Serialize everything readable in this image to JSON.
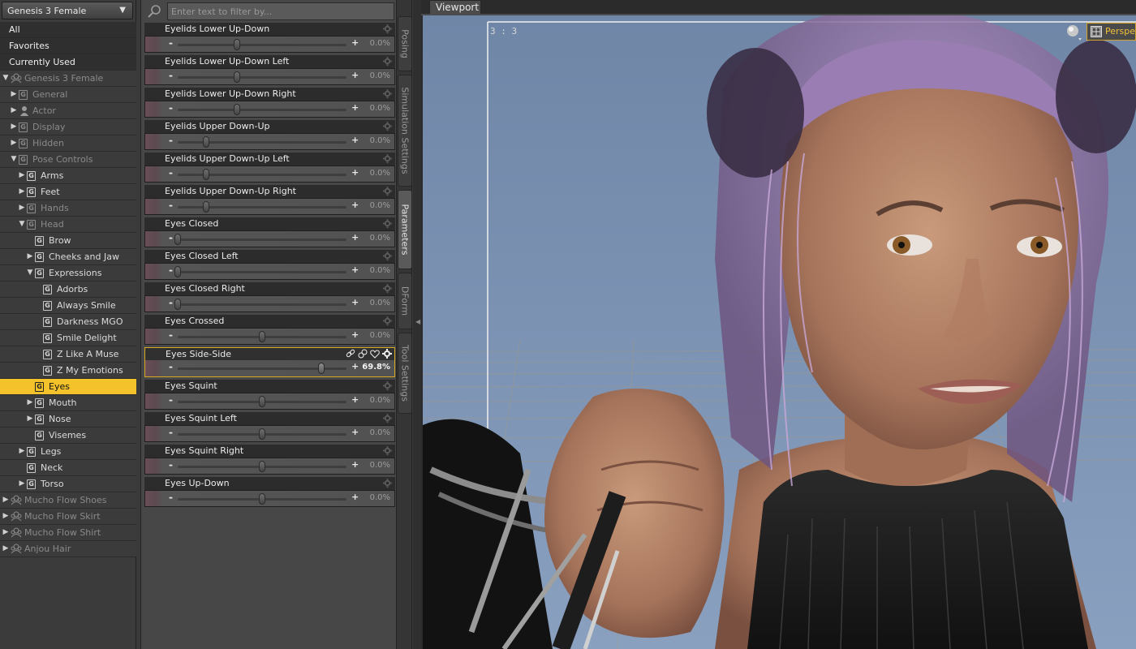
{
  "figure_selector": {
    "value": "Genesis 3 Female"
  },
  "tree": [
    {
      "label": "All",
      "kind": "top"
    },
    {
      "label": "Favorites",
      "kind": "top"
    },
    {
      "label": "Currently Used",
      "kind": "top"
    },
    {
      "label": "Genesis 3 Female",
      "kind": "figure",
      "depth": 0,
      "twisty": "open",
      "dim": true
    },
    {
      "label": "General",
      "kind": "group",
      "depth": 1,
      "twisty": "closed",
      "dim": true
    },
    {
      "label": "Actor",
      "kind": "actor",
      "depth": 1,
      "twisty": "closed",
      "dim": true
    },
    {
      "label": "Display",
      "kind": "group",
      "depth": 1,
      "twisty": "closed",
      "dim": true
    },
    {
      "label": "Hidden",
      "kind": "group",
      "depth": 1,
      "twisty": "closed",
      "dim": true
    },
    {
      "label": "Pose Controls",
      "kind": "group",
      "depth": 1,
      "twisty": "open",
      "dim": true
    },
    {
      "label": "Arms",
      "kind": "group",
      "depth": 2,
      "twisty": "closed"
    },
    {
      "label": "Feet",
      "kind": "group",
      "depth": 2,
      "twisty": "closed"
    },
    {
      "label": "Hands",
      "kind": "group",
      "depth": 2,
      "twisty": "closed",
      "dim": true
    },
    {
      "label": "Head",
      "kind": "group",
      "depth": 2,
      "twisty": "open",
      "dim": true
    },
    {
      "label": "Brow",
      "kind": "group",
      "depth": 3,
      "twisty": "none"
    },
    {
      "label": "Cheeks and Jaw",
      "kind": "group",
      "depth": 3,
      "twisty": "closed"
    },
    {
      "label": "Expressions",
      "kind": "group",
      "depth": 3,
      "twisty": "open"
    },
    {
      "label": "Adorbs",
      "kind": "group",
      "depth": 4,
      "twisty": "none"
    },
    {
      "label": "Always Smile",
      "kind": "group",
      "depth": 4,
      "twisty": "none"
    },
    {
      "label": "Darkness MGO",
      "kind": "group",
      "depth": 4,
      "twisty": "none"
    },
    {
      "label": "Smile Delight",
      "kind": "group",
      "depth": 4,
      "twisty": "none"
    },
    {
      "label": "Z Like A Muse",
      "kind": "group",
      "depth": 4,
      "twisty": "none"
    },
    {
      "label": "Z My Emotions",
      "kind": "group",
      "depth": 4,
      "twisty": "none"
    },
    {
      "label": "Eyes",
      "kind": "group",
      "depth": 3,
      "twisty": "none",
      "selected": true
    },
    {
      "label": "Mouth",
      "kind": "group",
      "depth": 3,
      "twisty": "closed"
    },
    {
      "label": "Nose",
      "kind": "group",
      "depth": 3,
      "twisty": "closed"
    },
    {
      "label": "Visemes",
      "kind": "group",
      "depth": 3,
      "twisty": "none"
    },
    {
      "label": "Legs",
      "kind": "group",
      "depth": 2,
      "twisty": "closed"
    },
    {
      "label": "Neck",
      "kind": "group",
      "depth": 2,
      "twisty": "none"
    },
    {
      "label": "Torso",
      "kind": "group",
      "depth": 2,
      "twisty": "closed"
    },
    {
      "label": "Mucho Flow Shoes",
      "kind": "figure",
      "depth": 0,
      "twisty": "closed",
      "dim": true
    },
    {
      "label": "Mucho Flow Skirt",
      "kind": "figure",
      "depth": 0,
      "twisty": "closed",
      "dim": true
    },
    {
      "label": "Mucho Flow Shirt",
      "kind": "figure",
      "depth": 0,
      "twisty": "closed",
      "dim": true
    },
    {
      "label": "Anjou Hair",
      "kind": "figure",
      "depth": 0,
      "twisty": "closed",
      "dim": true
    }
  ],
  "filter": {
    "placeholder": "Enter text to filter by..."
  },
  "params": [
    {
      "name": "Eyelids Lower Up-Down",
      "value": "0.0%",
      "pos": 0.35
    },
    {
      "name": "Eyelids Lower Up-Down Left",
      "value": "0.0%",
      "pos": 0.35
    },
    {
      "name": "Eyelids Lower Up-Down Right",
      "value": "0.0%",
      "pos": 0.35
    },
    {
      "name": "Eyelids Upper Down-Up",
      "value": "0.0%",
      "pos": 0.17
    },
    {
      "name": "Eyelids Upper Down-Up Left",
      "value": "0.0%",
      "pos": 0.17
    },
    {
      "name": "Eyelids Upper Down-Up Right",
      "value": "0.0%",
      "pos": 0.17
    },
    {
      "name": "Eyes Closed",
      "value": "0.0%",
      "pos": 0.0
    },
    {
      "name": "Eyes Closed Left",
      "value": "0.0%",
      "pos": 0.0
    },
    {
      "name": "Eyes Closed Right",
      "value": "0.0%",
      "pos": 0.0
    },
    {
      "name": "Eyes Crossed",
      "value": "0.0%",
      "pos": 0.5
    },
    {
      "name": "Eyes Side-Side",
      "value": "69.8%",
      "pos": 0.85,
      "active": true
    },
    {
      "name": "Eyes Squint",
      "value": "0.0%",
      "pos": 0.5
    },
    {
      "name": "Eyes Squint Left",
      "value": "0.0%",
      "pos": 0.5
    },
    {
      "name": "Eyes Squint Right",
      "value": "0.0%",
      "pos": 0.5
    },
    {
      "name": "Eyes Up-Down",
      "value": "0.0%",
      "pos": 0.5
    }
  ],
  "side_tabs": [
    "Posing",
    "Simulation Settings",
    "Parameters",
    "DForm",
    "Tool Settings"
  ],
  "active_side_tab": "Parameters",
  "viewport": {
    "tab": "Viewport",
    "aspect": "3 : 3",
    "camera": "Perspec"
  },
  "colors": {
    "selection": "#f4c22b",
    "active_border": "#d7a825",
    "sky": "#7f95b6"
  }
}
